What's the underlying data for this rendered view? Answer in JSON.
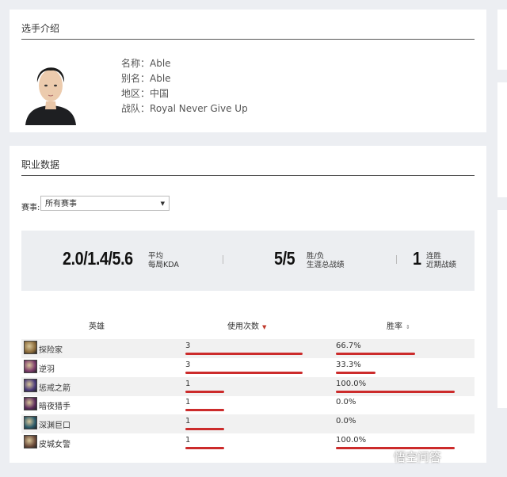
{
  "intro": {
    "title": "选手介绍",
    "fields": [
      {
        "label": "名称：",
        "value": "Able"
      },
      {
        "label": "别名：",
        "value": "Able"
      },
      {
        "label": "地区：",
        "value": "中国"
      },
      {
        "label": "战队：",
        "value": "Royal Never Give Up"
      }
    ]
  },
  "career": {
    "title": "职业数据",
    "filter": {
      "label": "赛事:",
      "selected": "所有赛事"
    },
    "stats": {
      "kda": {
        "value": "2.0/1.4/5.6",
        "line1": "平均",
        "line2": "每局KDA"
      },
      "record": {
        "value": "5/5",
        "line1": "胜/负",
        "line2": "生涯总战绩"
      },
      "streak": {
        "value": "1",
        "line1": "连胜",
        "line2": "近期战绩"
      }
    },
    "table": {
      "headers": {
        "hero": "英雄",
        "uses": "使用次数",
        "winrate": "胜率"
      },
      "rows": [
        {
          "hero": "探险家",
          "uses": "3",
          "winrate": "66.7%",
          "uses_frac": 1.0,
          "win_frac": 0.667,
          "icon_color": "#8a6a3a"
        },
        {
          "hero": "逆羽",
          "uses": "3",
          "winrate": "33.3%",
          "uses_frac": 1.0,
          "win_frac": 0.333,
          "icon_color": "#7a3a6a"
        },
        {
          "hero": "惩戒之箭",
          "uses": "1",
          "winrate": "100.0%",
          "uses_frac": 0.333,
          "win_frac": 1.0,
          "icon_color": "#4a3a7a"
        },
        {
          "hero": "暗夜猎手",
          "uses": "1",
          "winrate": "0.0%",
          "uses_frac": 0.333,
          "win_frac": 0.0,
          "icon_color": "#5a2a5a"
        },
        {
          "hero": "深渊巨口",
          "uses": "1",
          "winrate": "0.0%",
          "uses_frac": 0.333,
          "win_frac": 0.0,
          "icon_color": "#2a5a6a"
        },
        {
          "hero": "皮城女警",
          "uses": "1",
          "winrate": "100.0%",
          "uses_frac": 0.333,
          "win_frac": 1.0,
          "icon_color": "#6a4a3a"
        }
      ]
    }
  },
  "watermark": "悟空问答",
  "colors": {
    "bar": "#cc2b2b",
    "sort_active": "#c0392b"
  }
}
